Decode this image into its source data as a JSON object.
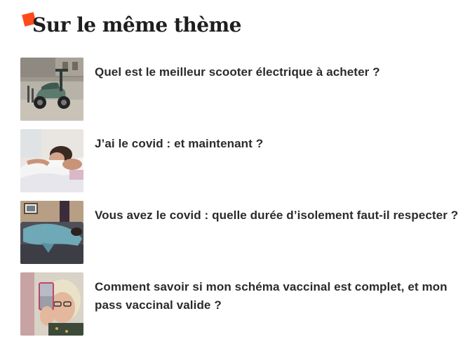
{
  "section": {
    "title": "Sur le même thème",
    "accent_color": "#ff4a1c"
  },
  "articles": [
    {
      "title": "Quel est le meilleur scooter électrique à acheter ?",
      "thumbnail_icon": "scooter-image"
    },
    {
      "title": "J’ai le covid : et maintenant ?",
      "thumbnail_icon": "sick-person-in-bed-image"
    },
    {
      "title": "Vous avez le covid : quelle durée d’isolement faut-il respecter ?",
      "thumbnail_icon": "person-under-blanket-on-couch-image"
    },
    {
      "title": "Comment savoir si mon schéma vaccinal est complet, et mon pass vaccinal valide ?",
      "thumbnail_icon": "woman-holding-phone-image"
    }
  ]
}
